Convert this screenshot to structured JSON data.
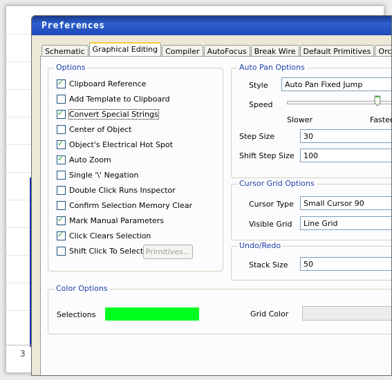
{
  "window": {
    "title": "Preferences"
  },
  "background": {
    "page_number": "3"
  },
  "tabs": [
    {
      "label": "Schematic",
      "active": false
    },
    {
      "label": "Graphical Editing",
      "active": true
    },
    {
      "label": "Compiler",
      "active": false
    },
    {
      "label": "AutoFocus",
      "active": false
    },
    {
      "label": "Break Wire",
      "active": false
    },
    {
      "label": "Default Primitives",
      "active": false
    },
    {
      "label": "Orcad (Tm) Ort",
      "active": false
    }
  ],
  "options": {
    "title": "Options",
    "items": [
      {
        "label": "Clipboard Reference",
        "checked": true
      },
      {
        "label": "Add Template to Clipboard",
        "checked": false
      },
      {
        "label": "Convert Special Strings",
        "checked": true
      },
      {
        "label": "Center of Object",
        "checked": false
      },
      {
        "label": "Object's Electrical Hot Spot",
        "checked": true
      },
      {
        "label": "Auto Zoom",
        "checked": true
      },
      {
        "label": "Single '\\' Negation",
        "checked": false
      },
      {
        "label": "Double Click Runs Inspector",
        "checked": false
      },
      {
        "label": "Confirm Selection Memory Clear",
        "checked": false
      },
      {
        "label": "Mark Manual Parameters",
        "checked": true
      },
      {
        "label": "Click Clears Selection",
        "checked": true
      },
      {
        "label": "Shift Click To Select",
        "checked": false
      }
    ],
    "primitives_button": "Primitives..."
  },
  "auto_pan": {
    "title": "Auto Pan Options",
    "style_label": "Style",
    "style_value": "Auto Pan Fixed Jump",
    "speed_label": "Speed",
    "speed_level": 0.75,
    "slower_label": "Slower",
    "faster_label": "Faster",
    "step_size_label": "Step Size",
    "step_size_value": "30",
    "shift_step_label": "Shift Step Size",
    "shift_step_value": "100"
  },
  "cursor_grid": {
    "title": "Cursor Grid Options",
    "cursor_type_label": "Cursor Type",
    "cursor_type_value": "Small Cursor 90",
    "visible_grid_label": "Visible Grid",
    "visible_grid_value": "Line Grid"
  },
  "undo_redo": {
    "title": "Undo/Redo",
    "stack_size_label": "Stack Size",
    "stack_size_value": "50"
  },
  "color_options": {
    "title": "Color Options",
    "selections_label": "Selections",
    "selections_color": "#00ff20",
    "grid_color_label": "Grid Color",
    "grid_color": "#ececec"
  }
}
